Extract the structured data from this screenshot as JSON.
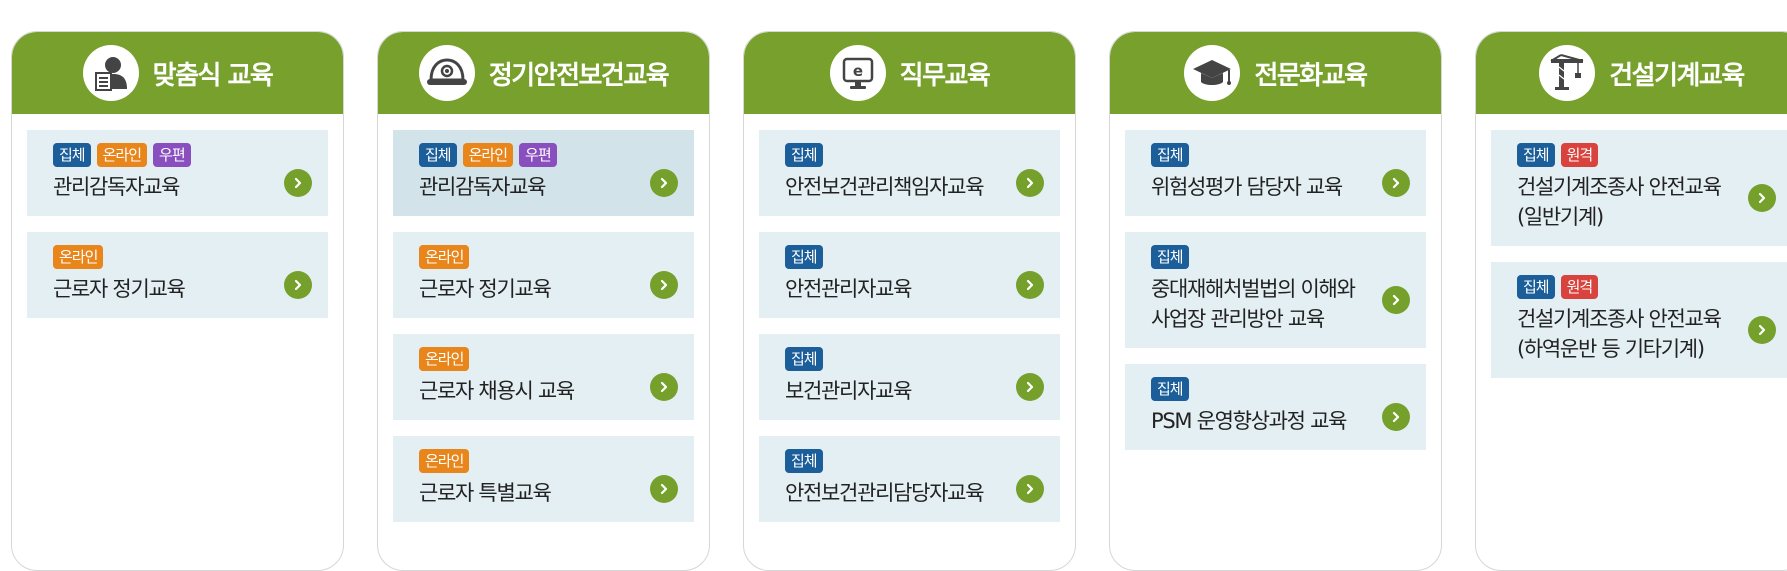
{
  "colors": {
    "header_green": "#77a02c",
    "item_bg": "#e4eff4",
    "badge_group": "#1b5e99",
    "badge_online": "#e8861c",
    "badge_mail": "#8a4fbf",
    "badge_remote": "#d9433e",
    "arrow_green": "#75a02c"
  },
  "categories": [
    {
      "title": "맞춤식 교육",
      "icon": "person-document-icon",
      "items": [
        {
          "badges": [
            {
              "label": "집체",
              "type": "group"
            },
            {
              "label": "온라인",
              "type": "online"
            },
            {
              "label": "우편",
              "type": "mail"
            }
          ],
          "title": "관리감독자교육"
        },
        {
          "badges": [
            {
              "label": "온라인",
              "type": "online"
            }
          ],
          "title": "근로자 정기교육"
        }
      ]
    },
    {
      "title": "정기안전보건교육",
      "icon": "safety-helmet-icon",
      "items": [
        {
          "badges": [
            {
              "label": "집체",
              "type": "group"
            },
            {
              "label": "온라인",
              "type": "online"
            },
            {
              "label": "우편",
              "type": "mail"
            }
          ],
          "title": "관리감독자교육",
          "active": true
        },
        {
          "badges": [
            {
              "label": "온라인",
              "type": "online"
            }
          ],
          "title": "근로자 정기교육"
        },
        {
          "badges": [
            {
              "label": "온라인",
              "type": "online"
            }
          ],
          "title": "근로자 채용시 교육"
        },
        {
          "badges": [
            {
              "label": "온라인",
              "type": "online"
            }
          ],
          "title": "근로자 특별교육"
        }
      ]
    },
    {
      "title": "직무교육",
      "icon": "e-learning-monitor-icon",
      "items": [
        {
          "badges": [
            {
              "label": "집체",
              "type": "group"
            }
          ],
          "title": "안전보건관리책임자교육"
        },
        {
          "badges": [
            {
              "label": "집체",
              "type": "group"
            }
          ],
          "title": "안전관리자교육"
        },
        {
          "badges": [
            {
              "label": "집체",
              "type": "group"
            }
          ],
          "title": "보건관리자교육"
        },
        {
          "badges": [
            {
              "label": "집체",
              "type": "group"
            }
          ],
          "title": "안전보건관리담당자교육"
        }
      ]
    },
    {
      "title": "전문화교육",
      "icon": "graduation-cap-icon",
      "items": [
        {
          "badges": [
            {
              "label": "집체",
              "type": "group"
            }
          ],
          "title": "위험성평가 담당자 교육"
        },
        {
          "badges": [
            {
              "label": "집체",
              "type": "group"
            }
          ],
          "title": "중대재해처벌법의 이해와\n사업장 관리방안 교육"
        },
        {
          "badges": [
            {
              "label": "집체",
              "type": "group"
            }
          ],
          "title": "PSM 운영향상과정 교육"
        }
      ]
    },
    {
      "title": "건설기계교육",
      "icon": "tower-crane-icon",
      "items": [
        {
          "badges": [
            {
              "label": "집체",
              "type": "group"
            },
            {
              "label": "원격",
              "type": "remote"
            }
          ],
          "title": "건설기계조종사 안전교육\n(일반기계)"
        },
        {
          "badges": [
            {
              "label": "집체",
              "type": "group"
            },
            {
              "label": "원격",
              "type": "remote"
            }
          ],
          "title": "건설기계조종사 안전교육\n(하역운반 등 기타기계)"
        }
      ]
    }
  ]
}
